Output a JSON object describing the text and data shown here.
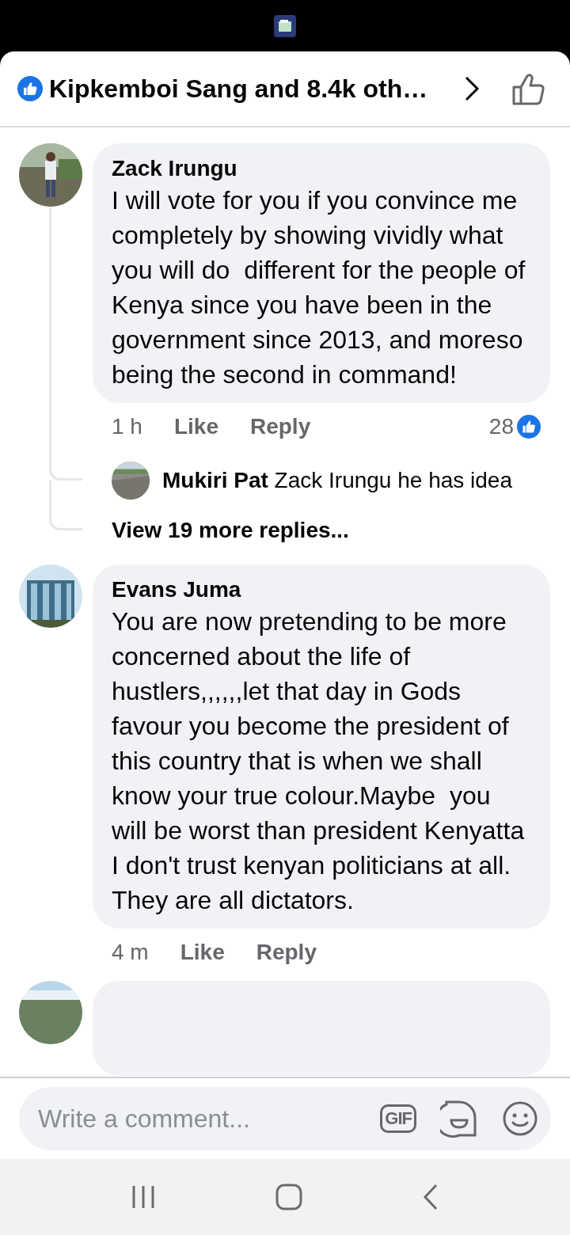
{
  "header": {
    "reaction_summary": "Kipkemboi Sang and 8.4k oth…"
  },
  "comments": [
    {
      "author": "Zack Irungu",
      "text": "I will vote for you if you convince me completely by showing vividly what you will do  different for the people of Kenya since you have been in the government since 2013, and moreso being the second in command!",
      "time": "1 h",
      "like_label": "Like",
      "reply_label": "Reply",
      "reaction_count": "28",
      "replies": [
        {
          "author": "Mukiri Pat",
          "text": "Zack Irungu he has idea"
        }
      ],
      "more_replies": "View 19 more replies..."
    },
    {
      "author": "Evans Juma",
      "text": "You are now pretending to be more concerned about the life of hustlers,,,,,,let that day in Gods favour you become the president of this country that is when we shall know your true colour.Maybe  you will be worst than president Kenyatta I don't trust kenyan politicians at all. They are all dictators.",
      "time": "4 m",
      "like_label": "Like",
      "reply_label": "Reply"
    },
    {
      "kind": "cut_off"
    }
  ],
  "composer": {
    "placeholder": "Write a comment...",
    "gif_label": "GIF"
  }
}
